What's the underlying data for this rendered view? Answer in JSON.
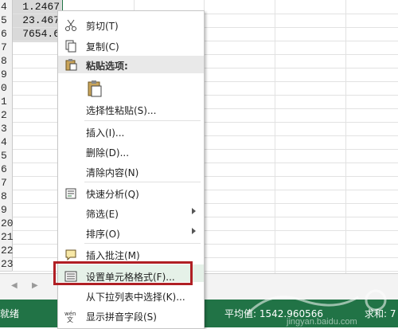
{
  "grid": {
    "rows": [
      {
        "num": "4",
        "value": "1.2467"
      },
      {
        "num": "5",
        "value": "23.467"
      },
      {
        "num": "6",
        "value": "7654.6"
      },
      {
        "num": "7",
        "value": ""
      },
      {
        "num": "8",
        "value": ""
      },
      {
        "num": "9",
        "value": ""
      },
      {
        "num": "0",
        "value": ""
      },
      {
        "num": "1",
        "value": ""
      },
      {
        "num": "2",
        "value": ""
      },
      {
        "num": "3",
        "value": ""
      },
      {
        "num": "4",
        "value": ""
      },
      {
        "num": "5",
        "value": ""
      },
      {
        "num": "6",
        "value": ""
      },
      {
        "num": "7",
        "value": ""
      },
      {
        "num": "8",
        "value": ""
      },
      {
        "num": "9",
        "value": ""
      },
      {
        "num": "20",
        "value": ""
      },
      {
        "num": "21",
        "value": ""
      },
      {
        "num": "22",
        "value": ""
      },
      {
        "num": "23",
        "value": ""
      }
    ]
  },
  "menu": {
    "cut": "剪切(T)",
    "copy": "复制(C)",
    "paste_header": "粘贴选项:",
    "paste_special": "选择性粘贴(S)...",
    "insert": "插入(I)...",
    "delete": "删除(D)...",
    "clear": "清除内容(N)",
    "quick_analysis": "快速分析(Q)",
    "filter": "筛选(E)",
    "sort": "排序(O)",
    "insert_comment": "插入批注(M)",
    "format_cells": "设置单元格格式(F)...",
    "pick_from_list": "从下拉列表中选择(K)...",
    "phonetic": "显示拼音字段(S)"
  },
  "status": {
    "ready": "就绪",
    "average": "平均值: 1542.960566",
    "sum": "求和: 7"
  },
  "watermark": {
    "text": "jingyan.baidu.com"
  },
  "colors": {
    "accent": "#217346",
    "highlight_border": "#b01f24"
  }
}
